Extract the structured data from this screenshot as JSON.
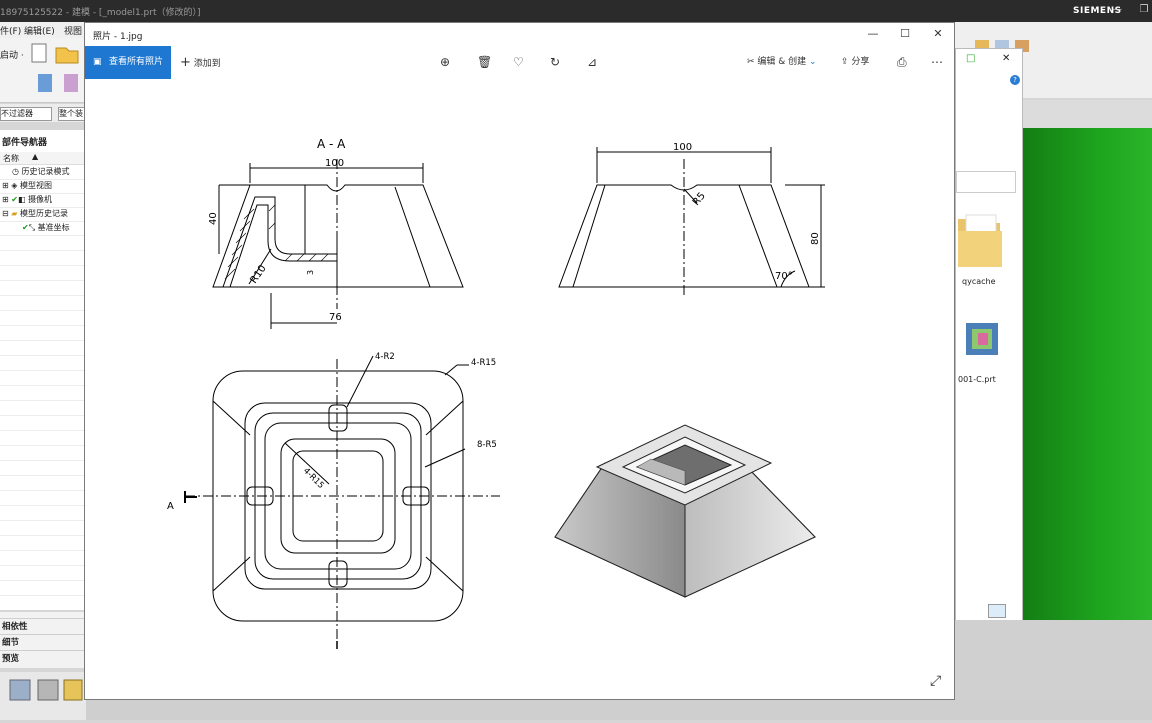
{
  "nx": {
    "title": "18975125522 - 建模 - [_model1.prt（修改的）]",
    "brand": "SIEMENS",
    "menu": [
      "件(F)",
      "编辑(E)",
      "视图"
    ],
    "ribbon_label": "启动 ·",
    "filter_value": "不过滤器",
    "filter2": "整个装",
    "navigator_title": "部件导航器",
    "column_name": "名称",
    "tree": [
      "历史记录模式",
      "模型视图",
      "摄像机",
      "模型历史记录",
      "基准坐标"
    ],
    "panels": [
      "相依性",
      "细节",
      "预览"
    ]
  },
  "photos": {
    "title": "照片 - 1.jpg",
    "see_all": "查看所有照片",
    "add_to": "添加到",
    "edit_create": "编辑 & 创建",
    "share": "分享"
  },
  "explorer": {
    "folder_label": "qycache",
    "file_label": "001-C.prt"
  },
  "drawing": {
    "section_label": "A - A",
    "dim_width": "100",
    "dim_height_left": "40",
    "dim_r10": "R10",
    "dim_3": "3",
    "dim_76": "76",
    "dim_width_right": "100",
    "dim_r5": "R5",
    "dim_80": "80",
    "dim_70": "70°",
    "callout_r2": "4-R2",
    "callout_r15": "4-R15",
    "callout_8r5": "8-R5",
    "callout_inner_r15": "4-R15",
    "section_mark": "A"
  },
  "colors": {
    "accent": "#1e78d2",
    "green": "#1ea51e"
  }
}
